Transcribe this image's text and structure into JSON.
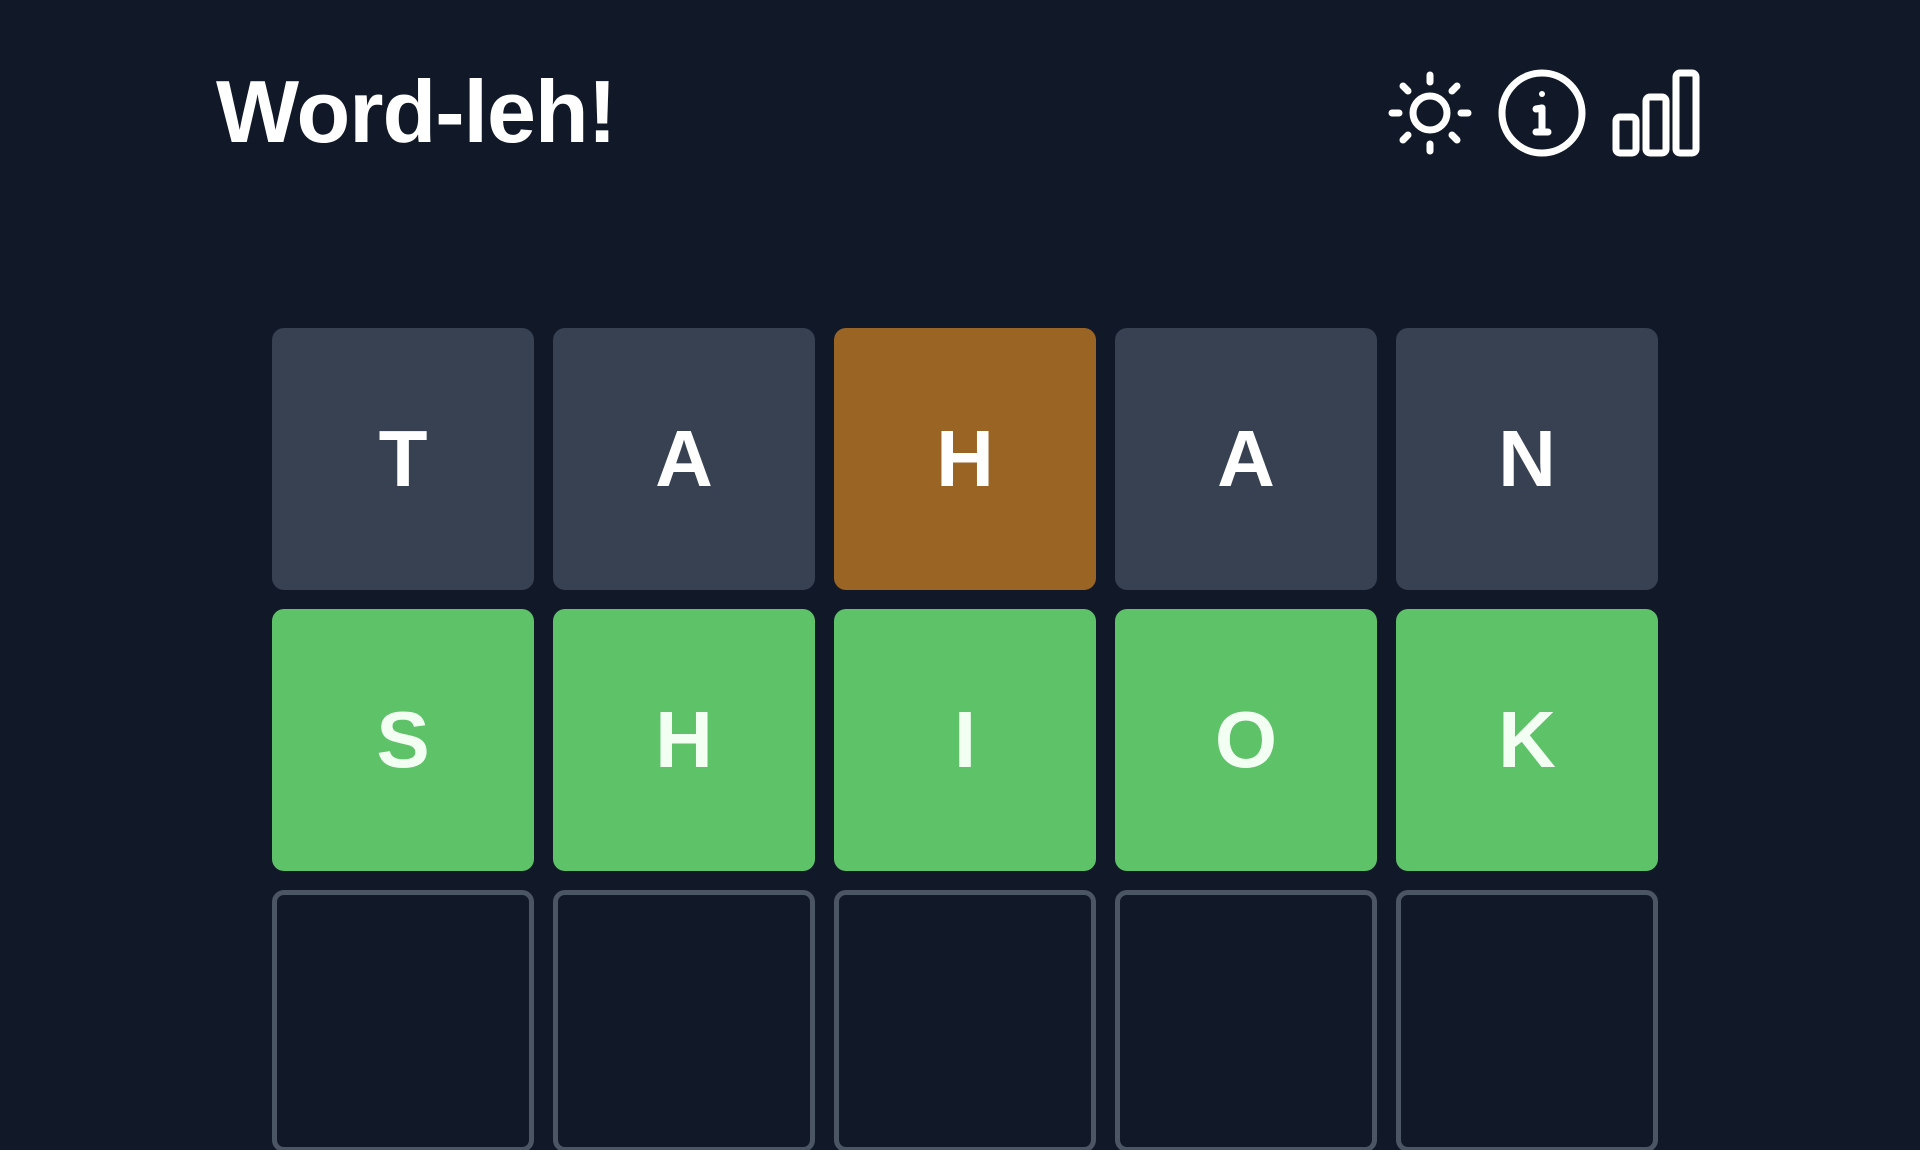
{
  "header": {
    "title": "Word-leh!",
    "icons": [
      "sun-icon",
      "info-icon",
      "stats-icon"
    ]
  },
  "board": {
    "rows": [
      [
        {
          "letter": "T",
          "state": "absent"
        },
        {
          "letter": "A",
          "state": "absent"
        },
        {
          "letter": "H",
          "state": "present"
        },
        {
          "letter": "A",
          "state": "absent"
        },
        {
          "letter": "N",
          "state": "absent"
        }
      ],
      [
        {
          "letter": "S",
          "state": "correct"
        },
        {
          "letter": "H",
          "state": "correct"
        },
        {
          "letter": "I",
          "state": "correct"
        },
        {
          "letter": "O",
          "state": "correct"
        },
        {
          "letter": "K",
          "state": "correct"
        }
      ],
      [
        {
          "letter": "",
          "state": "empty"
        },
        {
          "letter": "",
          "state": "empty"
        },
        {
          "letter": "",
          "state": "empty"
        },
        {
          "letter": "",
          "state": "empty"
        },
        {
          "letter": "",
          "state": "empty"
        }
      ]
    ]
  },
  "colors": {
    "background": "#111827",
    "absent": "#374151",
    "present": "#9a6524",
    "correct": "#5ec269",
    "empty_border": "#4b5563"
  }
}
